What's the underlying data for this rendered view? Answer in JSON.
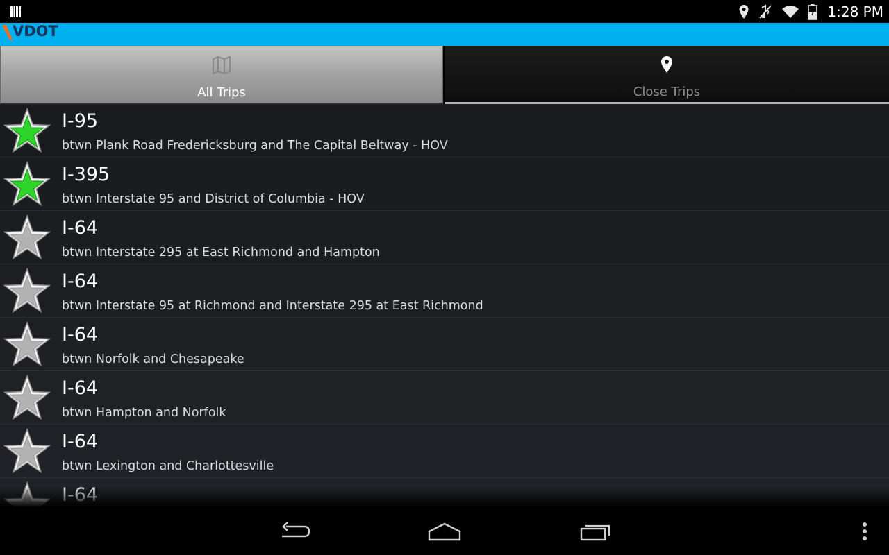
{
  "status_bar": {
    "time": "1:28 PM",
    "icons": [
      "barcode-icon",
      "location-icon",
      "mute-icon",
      "wifi-icon",
      "battery-icon"
    ]
  },
  "header": {
    "logo_text": "VDOT",
    "colors": {
      "bar": "#00b0ef",
      "logo_accent": "#f26d21",
      "logo_text": "#16355f"
    }
  },
  "tabs": [
    {
      "label": "All Trips",
      "icon": "map-icon",
      "active": true
    },
    {
      "label": "Close Trips",
      "icon": "location-pin-icon",
      "active": false
    }
  ],
  "trips": [
    {
      "route": "I-95",
      "description": "btwn Plank Road Fredericksburg and The Capital Beltway - HOV",
      "favorite": true
    },
    {
      "route": "I-395",
      "description": "btwn Interstate 95 and District of Columbia - HOV",
      "favorite": true
    },
    {
      "route": "I-64",
      "description": "btwn Interstate 295 at East Richmond and Hampton",
      "favorite": false
    },
    {
      "route": "I-64",
      "description": "btwn Interstate 95 at Richmond and Interstate 295 at East Richmond",
      "favorite": false
    },
    {
      "route": "I-64",
      "description": "btwn Norfolk and Chesapeake",
      "favorite": false
    },
    {
      "route": "I-64",
      "description": "btwn Hampton and Norfolk",
      "favorite": false
    },
    {
      "route": "I-64",
      "description": "btwn Lexington and Charlottesville",
      "favorite": false
    },
    {
      "route": "I-64",
      "description": "",
      "favorite": false
    }
  ],
  "nav_bar": {
    "buttons": [
      "back-icon",
      "home-icon",
      "recent-apps-icon",
      "overflow-menu-icon"
    ]
  }
}
